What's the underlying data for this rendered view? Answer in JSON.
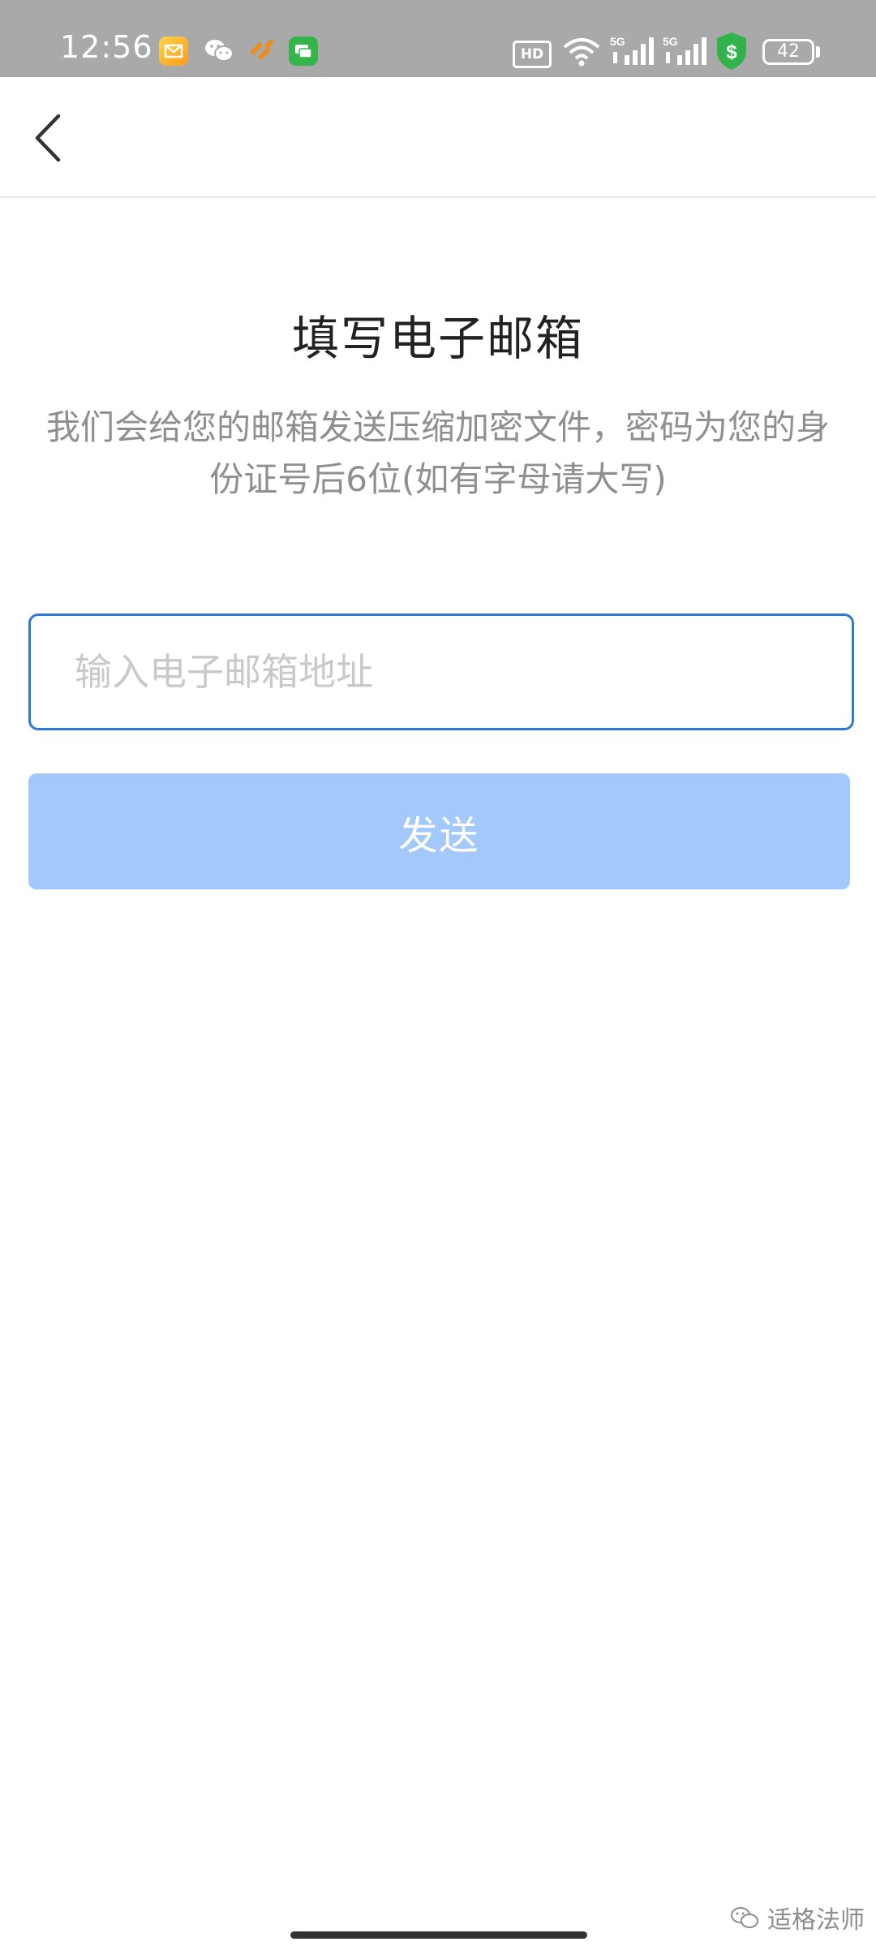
{
  "status_bar": {
    "time": "12:56",
    "hd_label": "HD",
    "network_1": "5G",
    "network_2": "5G",
    "battery_level": "42",
    "notification_icons": [
      "email-icon",
      "wechat-icon",
      "orange-app-icon",
      "chat-icon"
    ],
    "system_icons": [
      "wifi-icon",
      "signal-icon",
      "signal-icon",
      "shield-dollar-icon",
      "battery-icon"
    ]
  },
  "nav": {
    "back_icon": "chevron-left-icon"
  },
  "main": {
    "title": "填写电子邮箱",
    "description": "我们会给您的邮箱发送压缩加密文件，密码为您的身份证号后6位(如有字母请大写)",
    "email_input": {
      "value": "",
      "placeholder": "输入电子邮箱地址"
    },
    "send_button_label": "发送"
  },
  "watermark": {
    "text": "适格法师",
    "icon": "wechat-icon"
  },
  "colors": {
    "status_bar_bg": "#a9a9a9",
    "input_border": "#2e78d6",
    "button_bg": "#a3c9fb",
    "title_text": "#222222",
    "description_text": "#8f8f8f",
    "placeholder_text": "#c9c9c9"
  }
}
